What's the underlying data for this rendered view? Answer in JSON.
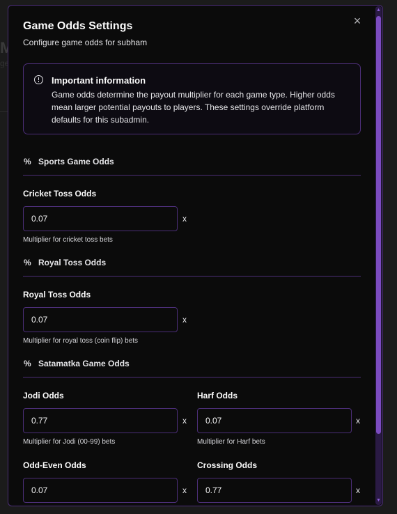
{
  "background": {
    "heading_fragment": "M",
    "sub_fragment": "ge"
  },
  "modal": {
    "title": "Game Odds Settings",
    "subtitle": "Configure game odds for subham",
    "close_label": "×"
  },
  "info": {
    "icon": "alert-circle-icon",
    "title": "Important information",
    "text": "Game odds determine the payout multiplier for each game type. Higher odds mean larger potential payouts to players. These settings override platform defaults for this subadmin."
  },
  "sections": {
    "sports": {
      "icon": "%",
      "label": "Sports Game Odds"
    },
    "royal": {
      "icon": "%",
      "label": "Royal Toss Odds"
    },
    "satamatka": {
      "icon": "%",
      "label": "Satamatka Game Odds"
    }
  },
  "fields": {
    "cricket_toss": {
      "label": "Cricket Toss Odds",
      "value": "0.07",
      "suffix": "x",
      "help": "Multiplier for cricket toss bets"
    },
    "royal_toss": {
      "label": "Royal Toss Odds",
      "value": "0.07",
      "suffix": "x",
      "help": "Multiplier for royal toss (coin flip) bets"
    },
    "jodi": {
      "label": "Jodi Odds",
      "value": "0.77",
      "suffix": "x",
      "help": "Multiplier for Jodi (00-99) bets"
    },
    "harf": {
      "label": "Harf Odds",
      "value": "0.07",
      "suffix": "x",
      "help": "Multiplier for Harf bets"
    },
    "odd_even": {
      "label": "Odd-Even Odds",
      "value": "0.07",
      "suffix": "x"
    },
    "crossing": {
      "label": "Crossing Odds",
      "value": "0.77",
      "suffix": "x"
    }
  },
  "colors": {
    "accent": "#7b4bbf",
    "border": "#4c2e78",
    "background": "#0b0b0b"
  }
}
